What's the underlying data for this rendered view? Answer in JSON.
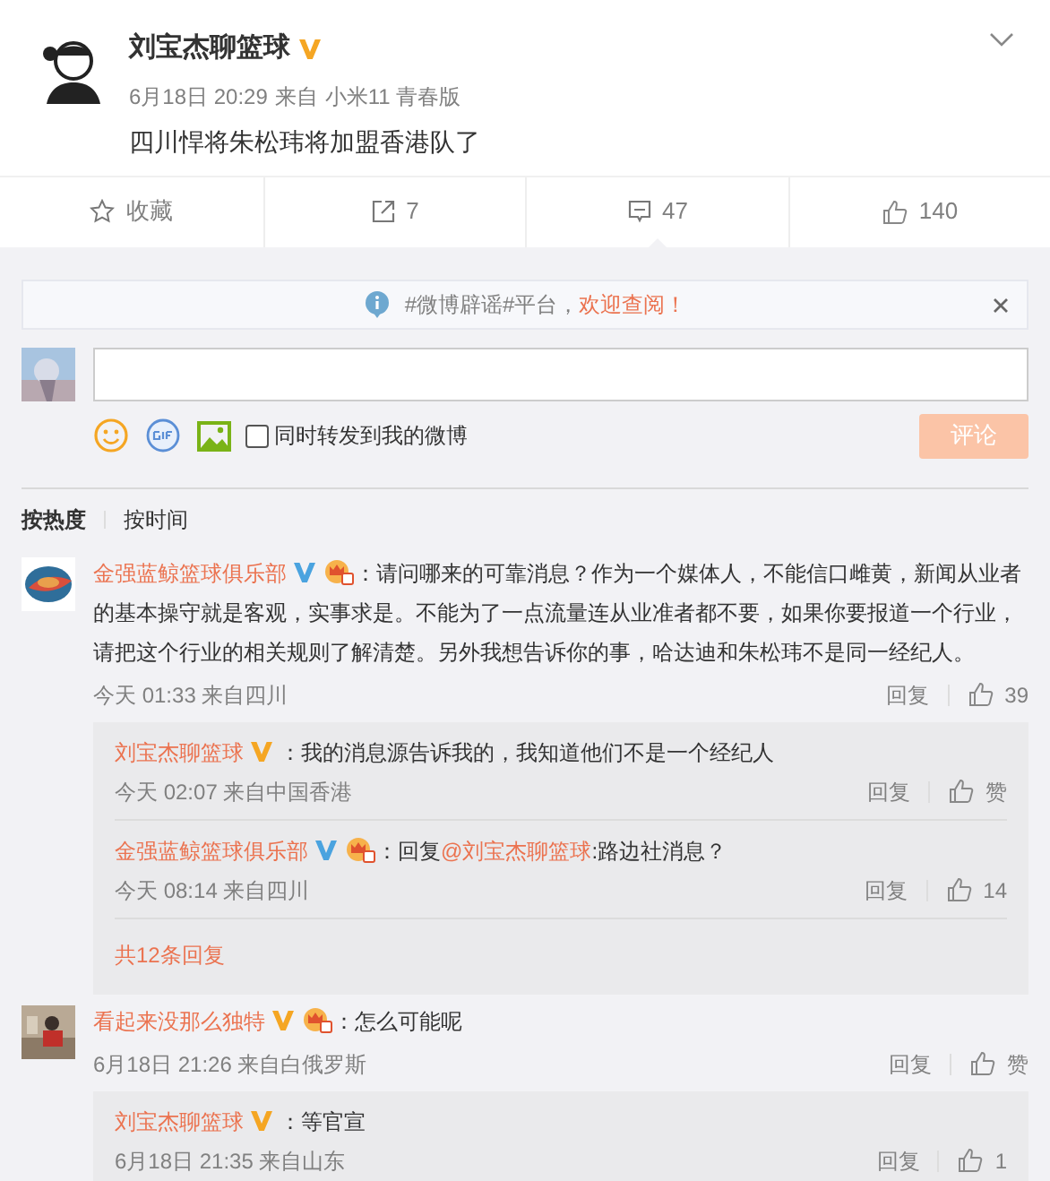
{
  "post": {
    "author": "刘宝杰聊篮球",
    "kind": "personal",
    "time": "6月18日 20:29",
    "source_prefix": "来自",
    "source": "小米11 青春版",
    "text": "四川悍将朱松玮将加盟香港队了"
  },
  "actions": [
    {
      "kind": "star",
      "label": "收藏"
    },
    {
      "kind": "share",
      "label": "7"
    },
    {
      "kind": "comment",
      "label": "47",
      "selected": true
    },
    {
      "kind": "like",
      "label": "140"
    }
  ],
  "notice": {
    "text": "#微博辟谣#平台，",
    "link": "欢迎查阅！"
  },
  "composer": {
    "forward_label": "同时转发到我的微博",
    "forward_checked": false,
    "submit": "评论",
    "submit_disabled": true
  },
  "sort_tabs": [
    {
      "label": "按热度",
      "selected": true
    },
    {
      "label": "按时间",
      "selected": false
    }
  ],
  "comments": [
    {
      "author": "金强蓝鲸篮球俱乐部",
      "kind": "organization",
      "member": true,
      "text": "：请问哪来的可靠消息？作为一个媒体人，不能信口雌黄，新闻从业者的基本操守就是客观，实事求是。不能为了一点流量连从业准者都不要，如果你要报道一个行业，请把这个行业的相关规则了解清楚。另外我想告诉你的事，哈达迪和朱松玮不是同一经纪人。",
      "time": "今天 01:33 来自四川",
      "reply": "回复",
      "likes": "39",
      "replies": [
        {
          "author": "刘宝杰聊篮球",
          "kind": "personal",
          "member": false,
          "text": "：我的消息源告诉我的，我知道他们不是一个经纪人",
          "time": "今天 02:07 来自中国香港",
          "reply": "回复",
          "likes": "赞"
        },
        {
          "author": "金强蓝鲸篮球俱乐部",
          "kind": "organization",
          "member": true,
          "prefix": "：回复",
          "mention": "@刘宝杰聊篮球",
          "text": ":路边社消息？",
          "time": "今天 08:14 来自四川",
          "reply": "回复",
          "likes": "14"
        }
      ],
      "more": "共12条回复"
    },
    {
      "author": "看起来没那么独特",
      "kind": "personal",
      "member": true,
      "text": "：怎么可能呢",
      "time": "6月18日 21:26 来自白俄罗斯",
      "reply": "回复",
      "likes": "赞",
      "replies": [
        {
          "author": "刘宝杰聊篮球",
          "kind": "personal",
          "member": false,
          "text": "：等官宣",
          "time": "6月18日 21:35 来自山东",
          "reply": "回复",
          "likes": "1"
        }
      ]
    }
  ]
}
